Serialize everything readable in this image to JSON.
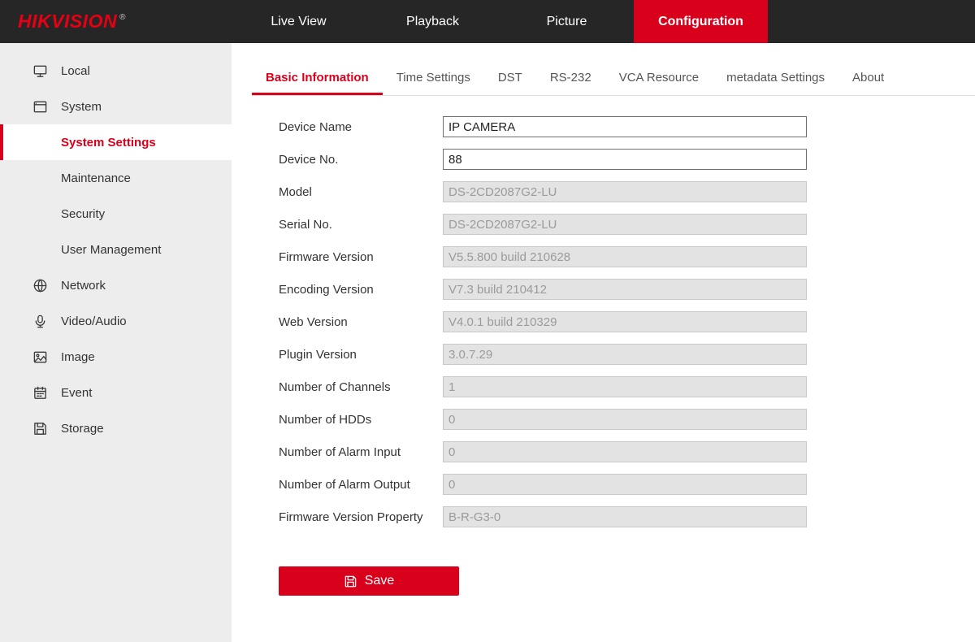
{
  "colors": {
    "accent_red": "#d9001c",
    "topbar_bg": "#262626",
    "sidebar_bg": "#ededed"
  },
  "header": {
    "logo": "HIKVISION",
    "logo_reg": "®",
    "nav": [
      {
        "label": "Live View",
        "active": false
      },
      {
        "label": "Playback",
        "active": false
      },
      {
        "label": "Picture",
        "active": false
      },
      {
        "label": "Configuration",
        "active": true
      }
    ]
  },
  "sidebar": {
    "items": [
      {
        "label": "Local",
        "icon": "monitor-icon"
      },
      {
        "label": "System",
        "icon": "system-icon"
      },
      {
        "label": "Network",
        "icon": "globe-icon"
      },
      {
        "label": "Video/Audio",
        "icon": "audio-icon"
      },
      {
        "label": "Image",
        "icon": "image-icon"
      },
      {
        "label": "Event",
        "icon": "calendar-icon"
      },
      {
        "label": "Storage",
        "icon": "disk-icon"
      }
    ],
    "system_submenu": [
      {
        "label": "System Settings",
        "active": true
      },
      {
        "label": "Maintenance",
        "active": false
      },
      {
        "label": "Security",
        "active": false
      },
      {
        "label": "User Management",
        "active": false
      }
    ]
  },
  "tabs": [
    "Basic Information",
    "Time Settings",
    "DST",
    "RS-232",
    "VCA Resource",
    "metadata Settings",
    "About"
  ],
  "form": {
    "rows": [
      {
        "label": "Device Name",
        "value": "IP CAMERA",
        "editable": true
      },
      {
        "label": "Device No.",
        "value": "88",
        "editable": true
      },
      {
        "label": "Model",
        "value": "DS-2CD2087G2-LU",
        "editable": false
      },
      {
        "label": "Serial No.",
        "value": "DS-2CD2087G2-LU",
        "editable": false
      },
      {
        "label": "Firmware Version",
        "value": "V5.5.800 build 210628",
        "editable": false
      },
      {
        "label": "Encoding Version",
        "value": "V7.3 build 210412",
        "editable": false
      },
      {
        "label": "Web Version",
        "value": "V4.0.1 build 210329",
        "editable": false
      },
      {
        "label": "Plugin Version",
        "value": "3.0.7.29",
        "editable": false
      },
      {
        "label": "Number of Channels",
        "value": "1",
        "editable": false
      },
      {
        "label": "Number of HDDs",
        "value": "0",
        "editable": false
      },
      {
        "label": "Number of Alarm Input",
        "value": "0",
        "editable": false
      },
      {
        "label": "Number of Alarm Output",
        "value": "0",
        "editable": false
      },
      {
        "label": "Firmware Version Property",
        "value": "B-R-G3-0",
        "editable": false
      }
    ]
  },
  "save": {
    "label": "Save"
  }
}
